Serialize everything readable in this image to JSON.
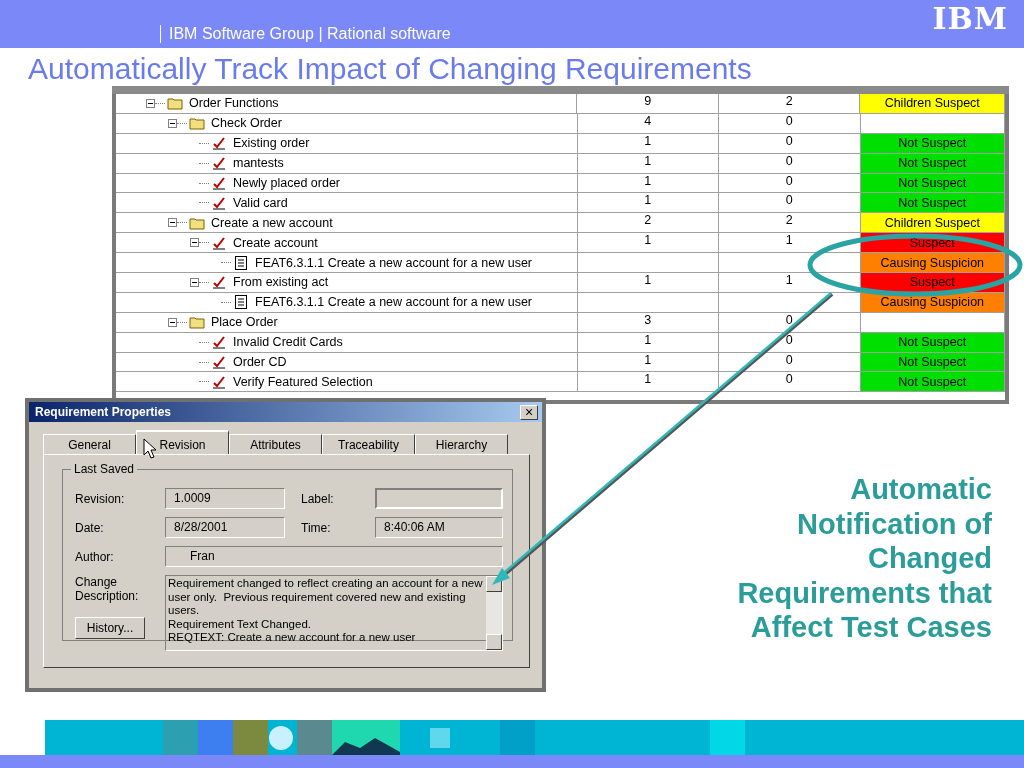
{
  "header": {
    "breadcrumb": "IBM Software Group | Rational software",
    "logo": "IBM"
  },
  "title": "Automatically Track Impact of Changing Requirements",
  "tree_table": {
    "rows": [
      {
        "label": "Order Functions",
        "kind": "folder",
        "expanded": true,
        "column_2": "9",
        "column_3": "2",
        "status": "Children Suspect",
        "color": "#ffff00",
        "children": [
          {
            "label": "Check Order",
            "kind": "folder",
            "expanded": true,
            "column_2": "4",
            "column_3": "0",
            "children": [
              {
                "label": "Existing order",
                "kind": "requirement",
                "column_2": "1",
                "column_3": "0",
                "status": "Not Suspect",
                "color": "#00e000"
              },
              {
                "label": "mantests",
                "kind": "requirement",
                "column_2": "1",
                "column_3": "0",
                "status": "Not Suspect",
                "color": "#00e000"
              },
              {
                "label": "Newly placed order",
                "kind": "requirement",
                "column_2": "1",
                "column_3": "0",
                "status": "Not Suspect",
                "color": "#00e000"
              },
              {
                "label": "Valid card",
                "kind": "requirement",
                "column_2": "1",
                "column_3": "0",
                "status": "Not Suspect",
                "color": "#00e000"
              }
            ]
          },
          {
            "label": "Create a new account",
            "kind": "folder",
            "expanded": true,
            "column_2": "2",
            "column_3": "2",
            "status": "Children Suspect",
            "color": "#ffff00",
            "children": [
              {
                "label": "Create account",
                "kind": "requirement",
                "expanded": true,
                "column_2": "1",
                "column_3": "1",
                "status": "Suspect",
                "color": "#ff0000",
                "children": [
                  {
                    "label": "FEAT6.3.1.1 Create a new account for a new user",
                    "kind": "document",
                    "status": "Causing Suspicion",
                    "color": "#ff8000"
                  }
                ]
              },
              {
                "label": "From existing act",
                "kind": "requirement",
                "expanded": true,
                "column_2": "1",
                "column_3": "1",
                "status": "Suspect",
                "color": "#ff0000",
                "children": [
                  {
                    "label": "FEAT6.3.1.1 Create a new account for a new user",
                    "kind": "document",
                    "status": "Causing Suspicion",
                    "color": "#ff8000"
                  }
                ]
              }
            ]
          },
          {
            "label": "Place Order",
            "kind": "folder",
            "expanded": true,
            "column_2": "3",
            "column_3": "0",
            "children": [
              {
                "label": "Invalid Credit Cards",
                "kind": "requirement",
                "column_2": "1",
                "column_3": "0",
                "status": "Not Suspect",
                "color": "#00e000"
              },
              {
                "label": "Order CD",
                "kind": "requirement",
                "column_2": "1",
                "column_3": "0",
                "status": "Not Suspect",
                "color": "#00e000"
              },
              {
                "label": "Verify Featured Selection",
                "kind": "requirement",
                "column_2": "1",
                "column_3": "0",
                "status": "Not Suspect",
                "color": "#00e000"
              }
            ]
          }
        ]
      }
    ]
  },
  "dialog": {
    "title": "Requirement Properties",
    "close": "×",
    "tabs": [
      {
        "label": "General",
        "selected": false
      },
      {
        "label": "Revision",
        "selected": true
      },
      {
        "label": "Attributes",
        "selected": false
      },
      {
        "label": "Traceability",
        "selected": false
      },
      {
        "label": "Hierarchy",
        "selected": false
      }
    ],
    "group": "Last Saved",
    "revision": {
      "label": "Revision:",
      "value": "1.0009"
    },
    "label_field": {
      "label": "Label:"
    },
    "date": {
      "label": "Date:",
      "value": "8/28/2001"
    },
    "time": {
      "label": "Time:",
      "value": "8:40:06 AM"
    },
    "author": {
      "label": "Author:",
      "value": "Fran"
    },
    "change_description": {
      "label": "Change Description:",
      "value": "Requirement changed to reflect creating an account for a new user only.  Previous requirement covered new and existing users.\nRequirement Text Changed.\nREQTEXT: Create a new account for a new user"
    },
    "history_button": "History..."
  },
  "callout": "Automatic Notification of Changed Requirements that Affect Test Cases"
}
